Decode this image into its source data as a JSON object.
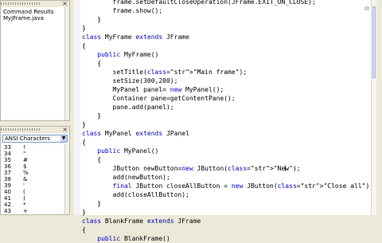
{
  "sidebar": {
    "top_panel": {
      "items": [
        "Command Results",
        "MyJFrame.java"
      ]
    },
    "bottom_panel": {
      "select_value": "ANSI Characters",
      "rows": [
        {
          "code": "33",
          "char": "!"
        },
        {
          "code": "34",
          "char": "\""
        },
        {
          "code": "35",
          "char": "#"
        },
        {
          "code": "36",
          "char": "$"
        },
        {
          "code": "37",
          "char": "%"
        },
        {
          "code": "38",
          "char": "&"
        },
        {
          "code": "39",
          "char": "'"
        },
        {
          "code": "40",
          "char": "("
        },
        {
          "code": "41",
          "char": ")"
        },
        {
          "code": "42",
          "char": "*"
        },
        {
          "code": "43",
          "char": "+"
        }
      ]
    },
    "close_symbol": "×"
  },
  "editor": {
    "code": "        frame.setDefaultCloseOperation(JFrame.EXIT_ON_CLOSE);\n        frame.show();\n    }\n}\nclass MyFrame extends JFrame\n{\n    public MyFrame()\n    {\n        setTitle(\"Main frame\");\n        setSize(300,200);\n        MyPanel panel= new MyPanel();\n        Container pane=getContentPane();\n        pane.add(panel);\n    }\n}\nclass MyPanel extends JPanel\n{\n    public MyPanel()\n    {\n        JButton newButton=new JButton(\"New\");\n        add(newButton);\n        final JButton closeAllButton = new JButton(\"Close all\");\n        add(closeAllButton);\n    }\n}\nclass BlankFrame extends JFrame\n{\n    public BlankFrame()"
  }
}
